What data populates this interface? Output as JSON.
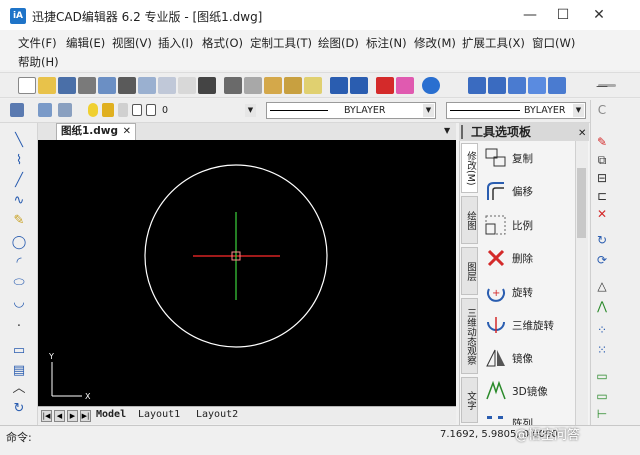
{
  "window": {
    "title": "迅捷CAD编辑器 6.2 专业版  - [图纸1.dwg]",
    "app_icon_text": "iA",
    "minimize": "—",
    "maximize": "☐",
    "close": "✕"
  },
  "menu": {
    "items": [
      "文件(F)",
      "编辑(E)",
      "视图(V)",
      "插入(I)",
      "格式(O)",
      "定制工具(T)",
      "绘图(D)",
      "标注(N)",
      "修改(M)",
      "扩展工具(X)",
      "窗口(W)",
      "帮助(H)"
    ]
  },
  "toolbar2": {
    "layer_value": "0",
    "linetype_value": "BYLAYER",
    "lineweight_value": "BYLAYER"
  },
  "document": {
    "tab_label": "图纸1.dwg",
    "tab_close": "✕"
  },
  "layout_tabs": [
    "Model",
    "Layout1",
    "Layout2"
  ],
  "axis": {
    "y_label": "Y",
    "x_label": "X"
  },
  "palette": {
    "title": "工具选项板",
    "side_tabs": [
      "修改(M)",
      "绘图",
      "图层",
      "三维动态观察",
      "文字"
    ],
    "items": [
      {
        "label": "复制",
        "icon": "copy-icon"
      },
      {
        "label": "偏移",
        "icon": "offset-icon"
      },
      {
        "label": "比例",
        "icon": "scale-icon"
      },
      {
        "label": "删除",
        "icon": "delete-icon"
      },
      {
        "label": "旋转",
        "icon": "rotate-icon"
      },
      {
        "label": "三维旋转",
        "icon": "rotate-3d-icon"
      },
      {
        "label": "镜像",
        "icon": "mirror-icon"
      },
      {
        "label": "3D镜像",
        "icon": "mirror-3d-icon"
      },
      {
        "label": "阵列",
        "icon": "array-icon"
      }
    ]
  },
  "status": {
    "command_label": "命令:",
    "coordinates": "7.1692, 5.9805, 0.0000",
    "watermark": "@悟空问答"
  },
  "colors": {
    "canvas_bg": "#000000",
    "circle": "#ffffff",
    "crosshair_h": "#ff2a2a",
    "crosshair_v": "#3cd23c",
    "accent": "#1f74c8"
  }
}
